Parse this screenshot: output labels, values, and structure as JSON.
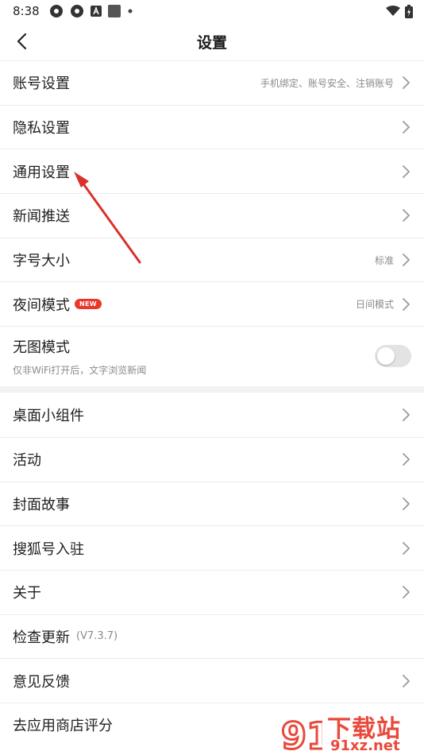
{
  "status_bar": {
    "time": "8:38"
  },
  "nav": {
    "title": "设置"
  },
  "settings_group1": [
    {
      "label": "账号设置",
      "hint": "手机绑定、账号安全、注销账号"
    },
    {
      "label": "隐私设置",
      "hint": ""
    },
    {
      "label": "通用设置",
      "hint": ""
    },
    {
      "label": "新闻推送",
      "hint": ""
    },
    {
      "label": "字号大小",
      "hint": "标准"
    },
    {
      "label": "夜间模式",
      "badge": "NEW",
      "hint": "日间模式"
    }
  ],
  "no_image_mode": {
    "label": "无图模式",
    "sub": "仅非WiFi打开后，文字浏览新闻",
    "enabled": false
  },
  "settings_group2": [
    {
      "label": "桌面小组件"
    },
    {
      "label": "活动"
    },
    {
      "label": "封面故事"
    },
    {
      "label": "搜狐号入驻"
    },
    {
      "label": "关于"
    },
    {
      "label": "检查更新",
      "version": "(V7.3.7)"
    },
    {
      "label": "意见反馈"
    },
    {
      "label": "去应用商店评分"
    }
  ],
  "watermark": {
    "brand": "下载站",
    "domain": "91xz.net",
    "logo_digits": "91"
  },
  "colors": {
    "accent_red": "#e8392a",
    "arrow_red": "#d9322b"
  }
}
